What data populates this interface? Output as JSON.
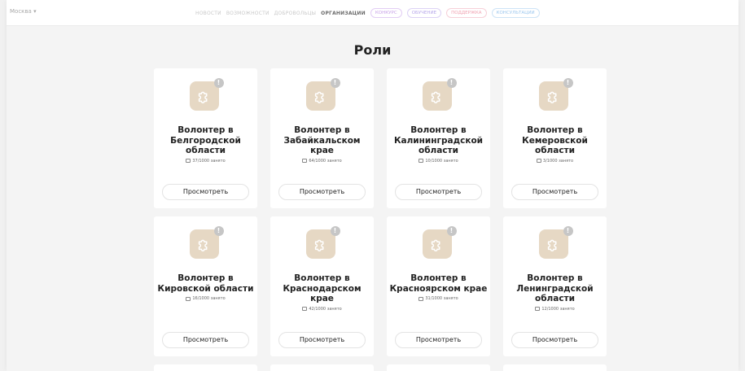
{
  "header": {
    "city": "Москва",
    "nav": [
      {
        "label": "НОВОСТИ",
        "style": "link"
      },
      {
        "label": "ВОЗМОЖНОСТИ",
        "style": "link"
      },
      {
        "label": "ДОБРОВОЛЬЦЫ",
        "style": "link"
      },
      {
        "label": "ОРГАНИЗАЦИИ",
        "style": "dark"
      },
      {
        "label": "КОНКУРС",
        "style": "p1"
      },
      {
        "label": "ОБУЧЕНИЕ",
        "style": "p2"
      },
      {
        "label": "ПОДДЕРЖКА",
        "style": "p3"
      },
      {
        "label": "КОНСУЛЬТАЦИИ",
        "style": "p4"
      }
    ]
  },
  "page_title": "Роли",
  "view_label": "Просмотреть",
  "badge": "!",
  "colors": {
    "tile": "#e6d8c4",
    "badge": "#c6c6c6"
  },
  "icons": {
    "tile": "puzzle-icon",
    "occupancy": "chat-icon",
    "badge": "exclamation-icon"
  },
  "roles": [
    {
      "name": "Волонтер в Белгородской области",
      "occupancy": "37/1000 занято"
    },
    {
      "name": "Волонтер в Забайкальском крае",
      "occupancy": "64/1000 занято"
    },
    {
      "name": "Волонтер в Калининградской области",
      "occupancy": "10/1000 занято"
    },
    {
      "name": "Волонтер в Кемеровской области",
      "occupancy": "3/1000 занято"
    },
    {
      "name": "Волонтер в Кировской области",
      "occupancy": "16/1000 занято"
    },
    {
      "name": "Волонтер в Краснодарском крае",
      "occupancy": "42/1000 занято"
    },
    {
      "name": "Волонтер в Красноярском крае",
      "occupancy": "31/1000 занято"
    },
    {
      "name": "Волонтер в Ленинградской области",
      "occupancy": "12/1000 занято"
    }
  ]
}
